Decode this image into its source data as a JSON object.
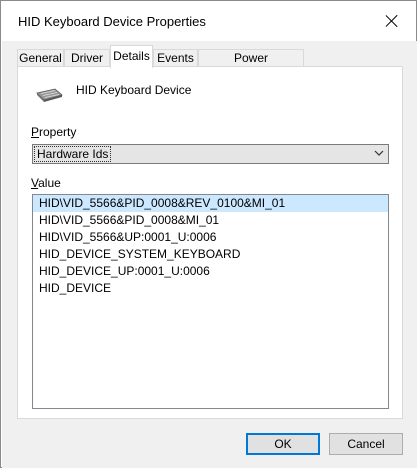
{
  "window": {
    "title": "HID Keyboard Device Properties"
  },
  "tabs": [
    {
      "label": "General"
    },
    {
      "label": "Driver"
    },
    {
      "label": "Details"
    },
    {
      "label": "Events"
    },
    {
      "label": "Power Management"
    }
  ],
  "active_tab": "Details",
  "device": {
    "name": "HID Keyboard Device",
    "icon": "keyboard-icon"
  },
  "property": {
    "label_access": "P",
    "label_rest": "roperty",
    "selected": "Hardware Ids"
  },
  "value": {
    "label_access": "V",
    "label_rest": "alue",
    "items": [
      "HID\\VID_5566&PID_0008&REV_0100&MI_01",
      "HID\\VID_5566&PID_0008&MI_01",
      "HID\\VID_5566&UP:0001_U:0006",
      "HID_DEVICE_SYSTEM_KEYBOARD",
      "HID_DEVICE_UP:0001_U:0006",
      "HID_DEVICE"
    ]
  },
  "buttons": {
    "ok": "OK",
    "cancel": "Cancel"
  },
  "colors": {
    "selection": "#cce8ff",
    "default_button_border": "#0078d7"
  }
}
